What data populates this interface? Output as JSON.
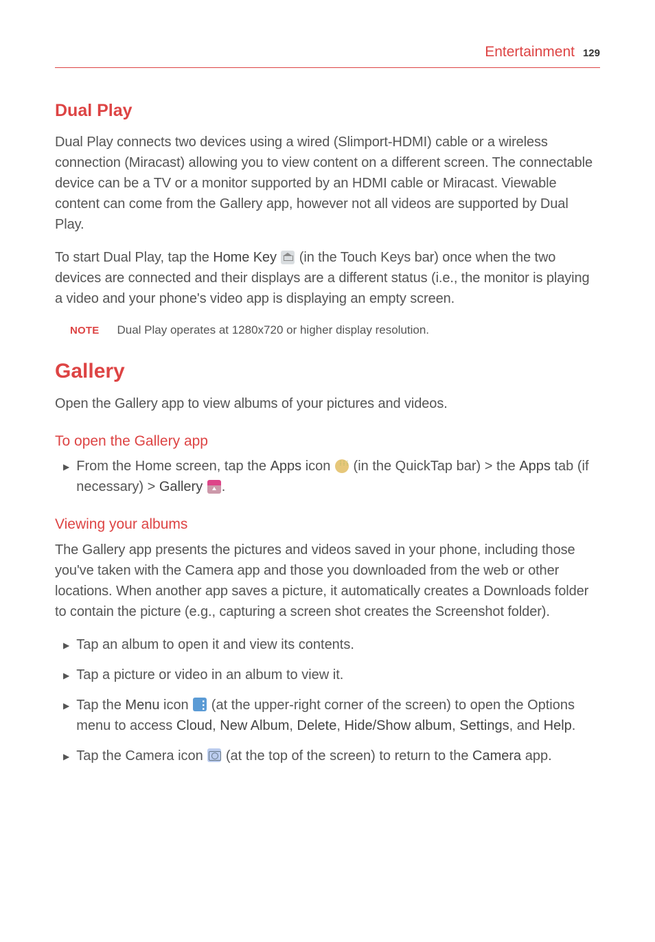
{
  "header": {
    "section": "Entertainment",
    "page": "129"
  },
  "dual_play": {
    "heading": "Dual Play",
    "p1": "Dual Play connects two devices using a wired (Slimport-HDMI) cable or a wireless connection (Miracast) allowing you to view content on a different screen. The connectable device can be a TV or a monitor supported by an HDMI cable or Miracast. Viewable content can come from the Gallery app, however not all videos are supported by Dual Play.",
    "p2_a": "To start Dual Play, tap the ",
    "p2_bold": "Home Key",
    "p2_b": " (in the Touch Keys bar) once when the two devices are connected and their displays are a different status (i.e., the monitor is playing a video and your phone's video app is displaying an empty screen.",
    "note_label": "NOTE",
    "note_text": "Dual Play operates at 1280x720 or higher display resolution."
  },
  "gallery": {
    "heading": "Gallery",
    "intro": "Open the Gallery app to view albums of your pictures and videos.",
    "sub1": "To open the Gallery app",
    "open_a": "From the Home screen, tap the ",
    "open_bold1": "Apps",
    "open_b": " icon ",
    "open_c": " (in the QuickTap bar) > the ",
    "open_bold2": "Apps",
    "open_d": " tab (if necessary) > ",
    "open_bold3": "Gallery",
    "open_e": ".",
    "sub2": "Viewing your albums",
    "viewing_p": "The Gallery app presents the pictures and videos saved in your phone, including those you've taken with the Camera app and those you downloaded from the web or other locations. When another app saves a picture, it automatically creates a Downloads folder to contain the picture (e.g., capturing a screen shot creates the Screenshot folder).",
    "b1": "Tap an album to open it and view its contents.",
    "b2": "Tap a picture or video in an album to view it.",
    "b3_a": "Tap the ",
    "b3_bold1": "Menu",
    "b3_b": " icon ",
    "b3_c": " (at the upper-right corner of the screen) to open the Options menu to access ",
    "b3_bold2": "Cloud",
    "b3_d": ", ",
    "b3_bold3": "New Album",
    "b3_e": ", ",
    "b3_bold4": "Delete",
    "b3_f": ", ",
    "b3_bold5": "Hide/Show album",
    "b3_g": ", ",
    "b3_bold6": "Settings",
    "b3_h": ", and ",
    "b3_bold7": "Help",
    "b3_i": ".",
    "b4_a": "Tap the Camera icon ",
    "b4_b": " (at the top of the screen) to return to the ",
    "b4_bold": "Camera",
    "b4_c": " app."
  }
}
